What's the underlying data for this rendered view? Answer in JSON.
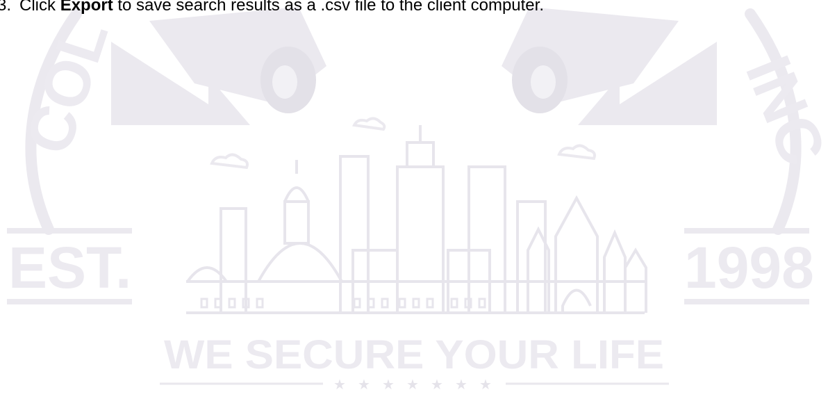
{
  "instruction": {
    "number": "3.",
    "prefix": "Click ",
    "bold": "Export",
    "suffix": " to save search results as a .csv file to the client computer."
  },
  "watermark": {
    "est": "EST.",
    "year": "1998",
    "tagline": "WE SECURE YOUR LIFE",
    "arc_left": "COL",
    "arc_right": "INC",
    "rating_stars": 7,
    "color": "#eceaf0",
    "line_color": "#ebe9ef"
  }
}
